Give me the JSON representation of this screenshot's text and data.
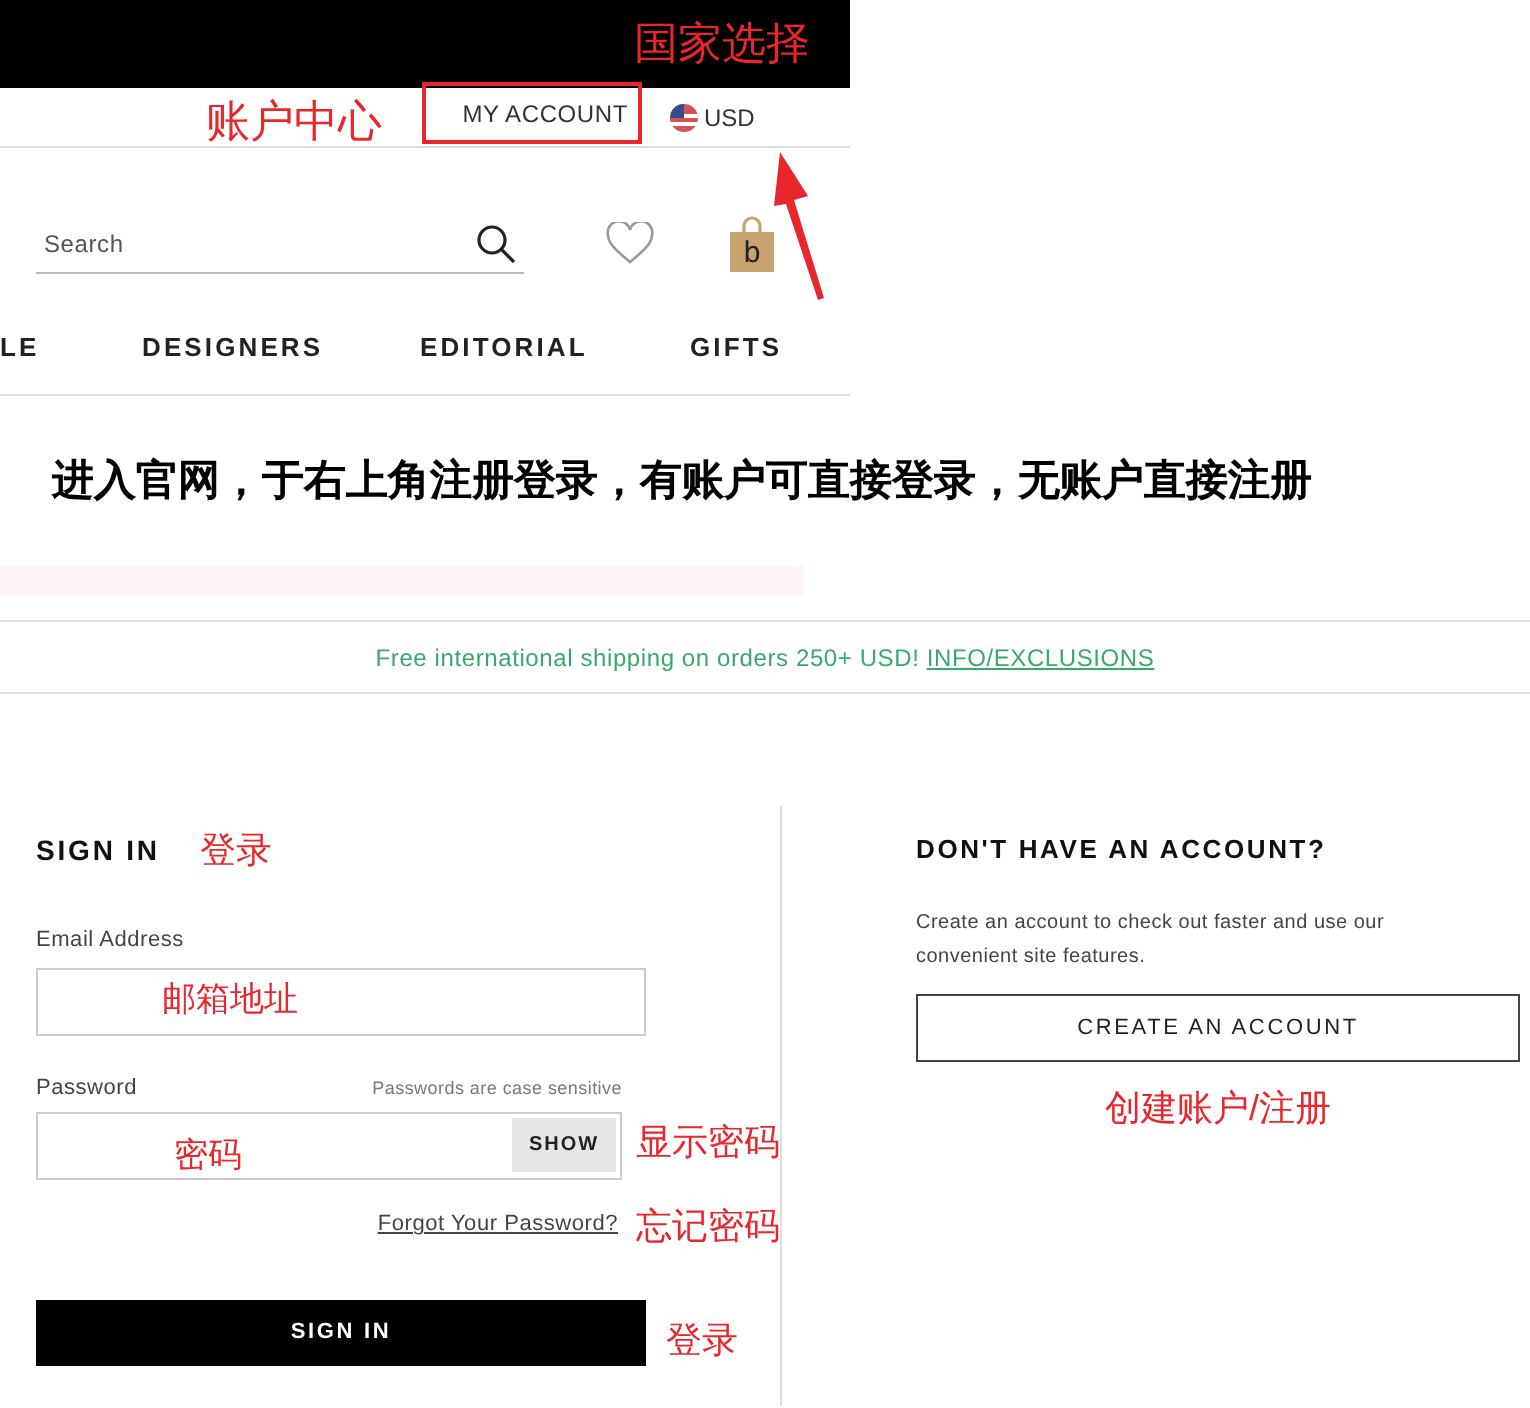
{
  "top_bar": {
    "note": "国家选择"
  },
  "utility": {
    "note": "账户中心",
    "account": "MY ACCOUNT",
    "currency": "USD"
  },
  "search": {
    "placeholder": "Search"
  },
  "cart": {
    "label": "b"
  },
  "nav": [
    "LE",
    "DESIGNERS",
    "EDITORIAL",
    "GIFTS"
  ],
  "caption": "进入官网，于右上角注册登录，有账户可直接登录，无账户直接注册",
  "promo": {
    "text": "Free international shipping on orders 250+ USD!",
    "link": "INFO/EXCLUSIONS"
  },
  "sign_in": {
    "title": "SIGN IN",
    "title_note": "登录",
    "email_label": "Email Address",
    "email_note": "邮箱地址",
    "password_label": "Password",
    "password_hint": "Passwords are case sensitive",
    "password_note": "密码",
    "show_button": "SHOW",
    "show_note": "显示密码",
    "forgot_link": "Forgot Your Password?",
    "forgot_note": "忘记密码",
    "submit": "SIGN IN",
    "submit_note": "登录"
  },
  "register": {
    "title": "DON'T HAVE AN ACCOUNT?",
    "description": "Create an account to check out faster and use our convenient site features.",
    "button": "CREATE AN ACCOUNT",
    "note": "创建账户/注册"
  }
}
